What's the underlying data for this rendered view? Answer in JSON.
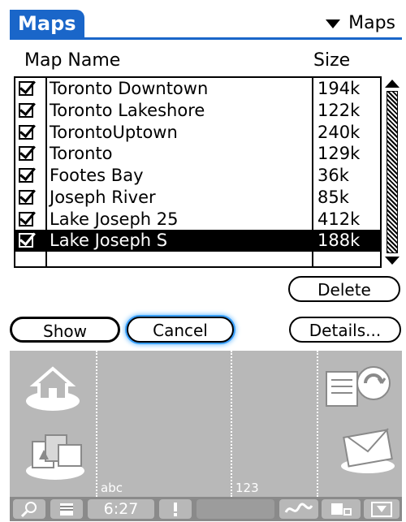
{
  "title_bar": {
    "title": "Maps",
    "menu_select_label": "Maps",
    "accent_color": "#1a66c9"
  },
  "columns": {
    "name_header": "Map Name",
    "size_header": "Size"
  },
  "maps": [
    {
      "name": "Toronto Downtown",
      "size": "194k",
      "checked": true,
      "selected": false
    },
    {
      "name": "Toronto Lakeshore",
      "size": "122k",
      "checked": true,
      "selected": false
    },
    {
      "name": "TorontoUptown",
      "size": "240k",
      "checked": true,
      "selected": false
    },
    {
      "name": "Toronto",
      "size": "129k",
      "checked": true,
      "selected": false
    },
    {
      "name": "Footes Bay",
      "size": "36k",
      "checked": true,
      "selected": false
    },
    {
      "name": "Joseph River",
      "size": "85k",
      "checked": true,
      "selected": false
    },
    {
      "name": "Lake Joseph 25",
      "size": "412k",
      "checked": true,
      "selected": false
    },
    {
      "name": "Lake Joseph S",
      "size": "188k",
      "checked": true,
      "selected": true
    }
  ],
  "buttons": {
    "delete": "Delete",
    "show": "Show",
    "cancel": "Cancel",
    "details": "Details..."
  },
  "graffiti": {
    "abc_label": "abc",
    "num_label": "123",
    "icons": [
      "home-icon",
      "applications-icon",
      "find-icon",
      "mail-icon"
    ]
  },
  "status_bar": {
    "clock": "6:27"
  }
}
